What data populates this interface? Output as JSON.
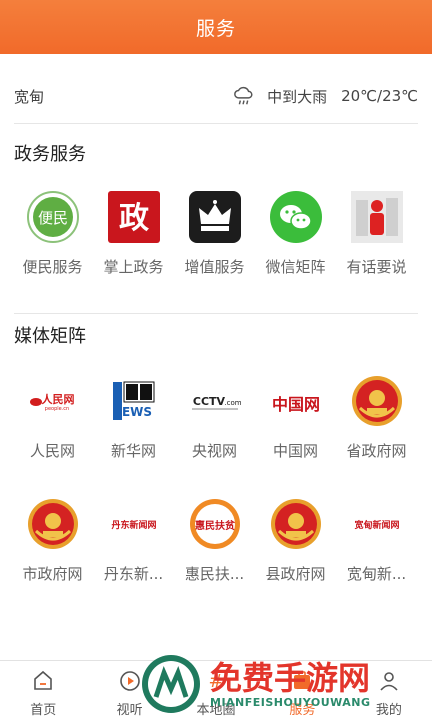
{
  "header": {
    "title": "服务"
  },
  "weather": {
    "city": "宽甸",
    "icon": "cloud-rain-icon",
    "desc": "中到大雨",
    "temp": "20℃/23℃"
  },
  "sections": {
    "gov": {
      "title": "政务服务",
      "items": [
        {
          "label": "便民服务",
          "icon": "bianmin-icon"
        },
        {
          "label": "掌上政务",
          "icon": "zheng-icon"
        },
        {
          "label": "增值服务",
          "icon": "crown-icon"
        },
        {
          "label": "微信矩阵",
          "icon": "wechat-icon"
        },
        {
          "label": "有话要说",
          "icon": "speak-icon"
        }
      ]
    },
    "media": {
      "title": "媒体矩阵",
      "items": [
        {
          "label": "人民网",
          "icon": "people-logo"
        },
        {
          "label": "新华网",
          "icon": "xinhua-logo"
        },
        {
          "label": "央视网",
          "icon": "cctv-logo"
        },
        {
          "label": "中国网",
          "icon": "china-logo"
        },
        {
          "label": "省政府网",
          "icon": "emblem-icon"
        },
        {
          "label": "市政府网",
          "icon": "emblem-icon"
        },
        {
          "label": "丹东新...",
          "icon": "dandong-logo"
        },
        {
          "label": "惠民扶...",
          "icon": "huimin-logo"
        },
        {
          "label": "县政府网",
          "icon": "emblem-icon"
        },
        {
          "label": "宽甸新...",
          "icon": "kuandian-logo"
        }
      ]
    }
  },
  "logo_text": {
    "bianmin": "便民",
    "zheng": "政",
    "people": "人民网",
    "people_url": "people.cn",
    "cctv": "CCTV",
    "cctv_com": ".com",
    "china": "中国网",
    "dandong": "丹东新闻网",
    "huimin": "惠民扶贫",
    "kuandian": "宽甸新闻网"
  },
  "tabs": [
    {
      "label": "首页",
      "icon": "home-icon"
    },
    {
      "label": "视听",
      "icon": "play-icon"
    },
    {
      "label": "本地圈",
      "icon": "hash-icon"
    },
    {
      "label": "服务",
      "icon": "service-icon",
      "active": true
    },
    {
      "label": "我的",
      "icon": "user-icon"
    }
  ],
  "watermark": {
    "cn": "免费手游网",
    "en": "MIANFEISHOUYOUWANG"
  },
  "colors": {
    "accent": "#f16a2a",
    "wechat": "#3bbd3b",
    "zheng_red": "#c9161d"
  }
}
